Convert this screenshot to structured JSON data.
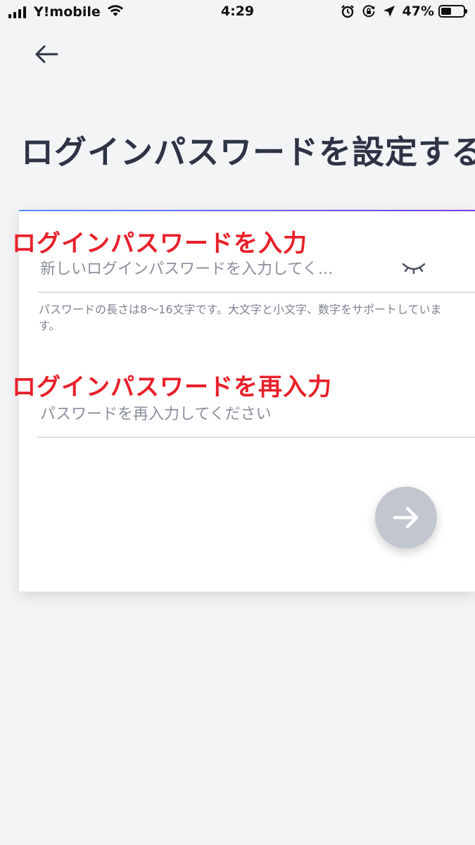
{
  "status_bar": {
    "carrier": "Y!mobile",
    "time": "4:29",
    "battery_percent": "47%",
    "battery_level": 0.47,
    "icons": [
      "signal-icon",
      "wifi-icon",
      "alarm-icon",
      "orientation-lock-icon",
      "location-icon",
      "battery-icon"
    ]
  },
  "header": {
    "back_icon": "arrow-left-icon",
    "title": "ログインパスワードを設定する"
  },
  "form": {
    "password_label": "ログインパスワードを入力",
    "password_placeholder": "新しいログインパスワードを入力してく…",
    "eye_icon": "eye-closed-icon",
    "hint": "パスワードの長さは8～16文字です。大文字と小文字、数字をサポートしています。",
    "confirm_label": "ログインパスワードを再入力",
    "confirm_placeholder": "パスワードを再入力してください",
    "next_icon": "arrow-right-icon"
  },
  "colors": {
    "background": "#f3f4f6",
    "label_red": "#e8202a",
    "title": "#2e3446",
    "button_disabled": "#c2c6cf"
  }
}
